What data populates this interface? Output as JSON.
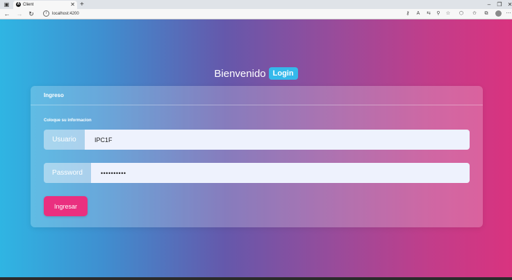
{
  "browser": {
    "tab_title": "Client",
    "tab_favicon": "A",
    "url": "localhost:4200"
  },
  "page": {
    "welcome_text": "Bienvenido",
    "badge_text": "Login",
    "card_header": "Ingreso",
    "instruction": "Coloque su informacion",
    "username_label": "Usuario",
    "username_value": "IPC1F",
    "password_label": "Password",
    "password_value": "••••••••••",
    "submit_label": "Ingresar"
  },
  "colors": {
    "gradient_start": "#2fb5e3",
    "gradient_end": "#d9337f",
    "badge": "#35b9eb",
    "submit_button": "#ea2f7f"
  }
}
